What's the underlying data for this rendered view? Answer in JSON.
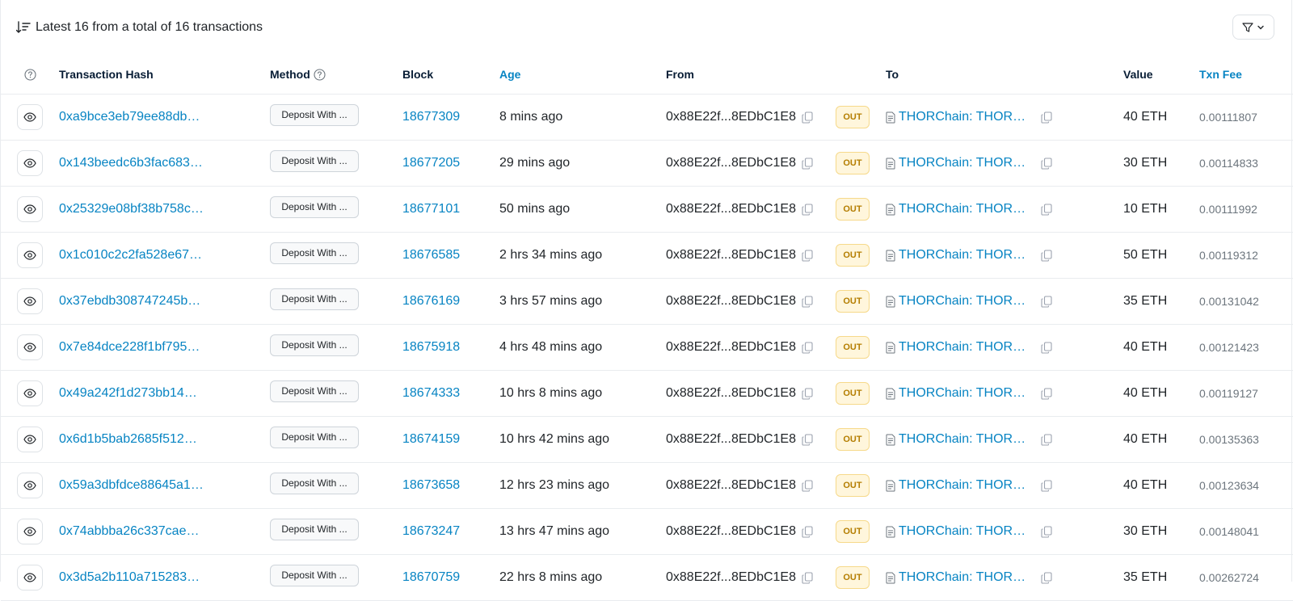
{
  "summary": {
    "text": "Latest 16 from a total of 16 transactions"
  },
  "columns": {
    "hash": "Transaction Hash",
    "method": "Method",
    "block": "Block",
    "age": "Age",
    "from": "From",
    "to": "To",
    "value": "Value",
    "fee": "Txn Fee"
  },
  "colors": {
    "link": "#0784c3",
    "out_badge_bg": "#fff6dc",
    "out_badge_text": "#b47d00"
  },
  "rows": [
    {
      "hash": "0xa9bce3eb79ee88db…",
      "method": "Deposit With ...",
      "block": "18677309",
      "age": "8 mins ago",
      "from": "0x88E22f...8EDbC1E8",
      "dir": "OUT",
      "to": "THORChain: THORChain Router",
      "value": "40 ETH",
      "fee": "0.00111807"
    },
    {
      "hash": "0x143beedc6b3fac683…",
      "method": "Deposit With ...",
      "block": "18677205",
      "age": "29 mins ago",
      "from": "0x88E22f...8EDbC1E8",
      "dir": "OUT",
      "to": "THORChain: THORChain Router",
      "value": "30 ETH",
      "fee": "0.00114833"
    },
    {
      "hash": "0x25329e08bf38b758c…",
      "method": "Deposit With ...",
      "block": "18677101",
      "age": "50 mins ago",
      "from": "0x88E22f...8EDbC1E8",
      "dir": "OUT",
      "to": "THORChain: THORChain Router",
      "value": "10 ETH",
      "fee": "0.00111992"
    },
    {
      "hash": "0x1c010c2c2fa528e67…",
      "method": "Deposit With ...",
      "block": "18676585",
      "age": "2 hrs 34 mins ago",
      "from": "0x88E22f...8EDbC1E8",
      "dir": "OUT",
      "to": "THORChain: THORChain Router",
      "value": "50 ETH",
      "fee": "0.00119312"
    },
    {
      "hash": "0x37ebdb308747245b…",
      "method": "Deposit With ...",
      "block": "18676169",
      "age": "3 hrs 57 mins ago",
      "from": "0x88E22f...8EDbC1E8",
      "dir": "OUT",
      "to": "THORChain: THORChain Router",
      "value": "35 ETH",
      "fee": "0.00131042"
    },
    {
      "hash": "0x7e84dce228f1bf795…",
      "method": "Deposit With ...",
      "block": "18675918",
      "age": "4 hrs 48 mins ago",
      "from": "0x88E22f...8EDbC1E8",
      "dir": "OUT",
      "to": "THORChain: THORChain Router",
      "value": "40 ETH",
      "fee": "0.00121423"
    },
    {
      "hash": "0x49a242f1d273bb14…",
      "method": "Deposit With ...",
      "block": "18674333",
      "age": "10 hrs 8 mins ago",
      "from": "0x88E22f...8EDbC1E8",
      "dir": "OUT",
      "to": "THORChain: THORChain Router",
      "value": "40 ETH",
      "fee": "0.00119127"
    },
    {
      "hash": "0x6d1b5bab2685f512…",
      "method": "Deposit With ...",
      "block": "18674159",
      "age": "10 hrs 42 mins ago",
      "from": "0x88E22f...8EDbC1E8",
      "dir": "OUT",
      "to": "THORChain: THORChain Router",
      "value": "40 ETH",
      "fee": "0.00135363"
    },
    {
      "hash": "0x59a3dbfdce88645a1…",
      "method": "Deposit With ...",
      "block": "18673658",
      "age": "12 hrs 23 mins ago",
      "from": "0x88E22f...8EDbC1E8",
      "dir": "OUT",
      "to": "THORChain: THORChain Router",
      "value": "40 ETH",
      "fee": "0.00123634"
    },
    {
      "hash": "0x74abbba26c337cae…",
      "method": "Deposit With ...",
      "block": "18673247",
      "age": "13 hrs 47 mins ago",
      "from": "0x88E22f...8EDbC1E8",
      "dir": "OUT",
      "to": "THORChain: THORChain Router",
      "value": "30 ETH",
      "fee": "0.00148041"
    },
    {
      "hash": "0x3d5a2b110a715283…",
      "method": "Deposit With ...",
      "block": "18670759",
      "age": "22 hrs 8 mins ago",
      "from": "0x88E22f...8EDbC1E8",
      "dir": "OUT",
      "to": "THORChain: THORChain Router",
      "value": "35 ETH",
      "fee": "0.00262724"
    }
  ]
}
